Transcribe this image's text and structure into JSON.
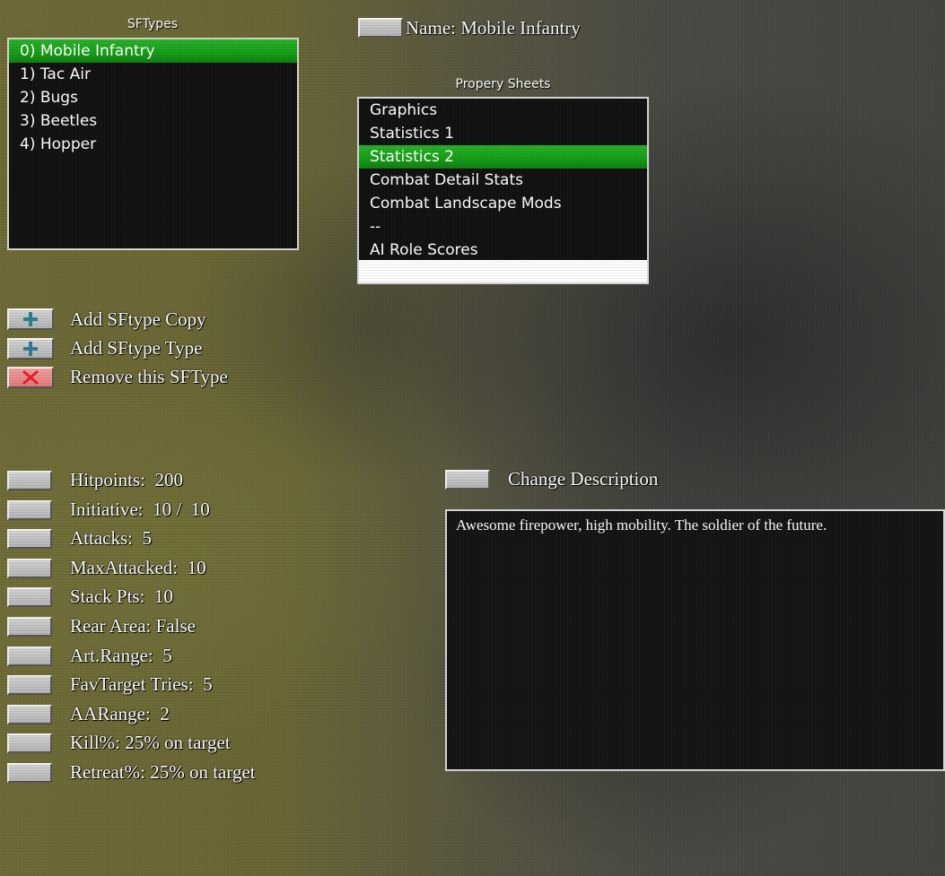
{
  "sftypes": {
    "title": "SFTypes",
    "items": [
      {
        "label": "0) Mobile Infantry",
        "selected": true
      },
      {
        "label": "1) Tac Air",
        "selected": false
      },
      {
        "label": "2) Bugs",
        "selected": false
      },
      {
        "label": "3) Beetles",
        "selected": false
      },
      {
        "label": "4) Hopper",
        "selected": false
      }
    ]
  },
  "name_field": {
    "label": "Name: Mobile Infantry"
  },
  "property_sheets": {
    "title": "Propery Sheets",
    "items": [
      {
        "label": "Graphics",
        "selected": false
      },
      {
        "label": "Statistics 1",
        "selected": false
      },
      {
        "label": "Statistics 2",
        "selected": true
      },
      {
        "label": "Combat Detail Stats",
        "selected": false
      },
      {
        "label": "Combat Landscape Mods",
        "selected": false
      },
      {
        "label": "--",
        "selected": false
      },
      {
        "label": "AI Role Scores",
        "selected": false
      }
    ]
  },
  "actions": {
    "add_copy": "Add SFtype Copy",
    "add_type": "Add SFtype Type",
    "remove": "Remove this SFType"
  },
  "stats": [
    "Hitpoints:  200",
    "Initiative:  10 /  10",
    "Attacks:  5",
    "MaxAttacked:  10",
    "Stack Pts:  10",
    "Rear Area: False",
    "Art.Range:  5",
    "FavTarget Tries:  5",
    "AARange:  2",
    "Kill%: 25% on target",
    "Retreat%: 25% on target"
  ],
  "description": {
    "change_label": "Change Description",
    "text": "Awesome firepower, high mobility.  The soldier of the future."
  },
  "colors": {
    "selection_green": "#1aa51a",
    "plus_icon": "#2a7e92",
    "remove_icon": "#e82020",
    "remove_button_bg": "#ef8f8f"
  }
}
